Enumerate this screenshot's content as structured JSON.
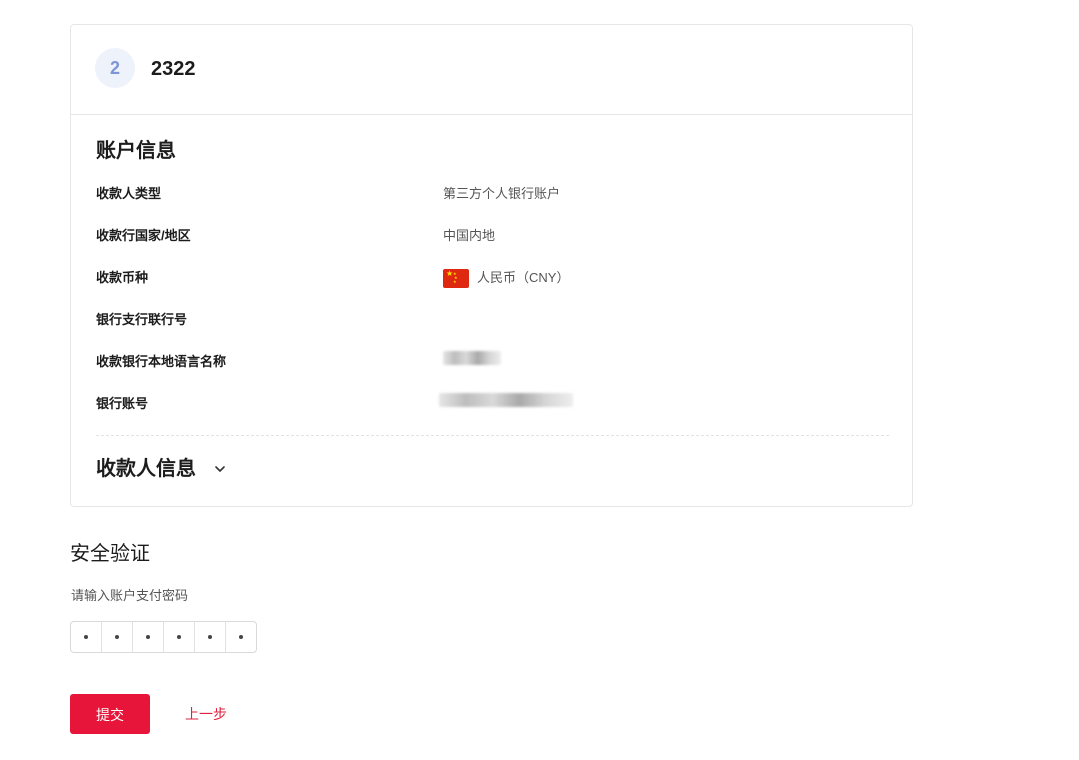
{
  "card": {
    "step_number": "2",
    "title": "2322"
  },
  "account_info": {
    "title": "账户信息",
    "rows": [
      {
        "label": "收款人类型",
        "value": "第三方个人银行账户"
      },
      {
        "label": "收款行国家/地区",
        "value": "中国内地"
      },
      {
        "label": "收款币种",
        "value": "人民币（CNY）",
        "icon": "china-flag-icon"
      },
      {
        "label": "银行支行联行号",
        "value": ""
      },
      {
        "label": "收款银行本地语言名称",
        "value": ""
      },
      {
        "label": "银行账号",
        "value": ""
      }
    ]
  },
  "payee_info": {
    "title": "收款人信息",
    "icon": "chevron-down-icon"
  },
  "security": {
    "title": "安全验证",
    "password_label": "请输入账户支付密码",
    "password_length": 6,
    "password_filled": 6
  },
  "actions": {
    "submit_label": "提交",
    "back_label": "上一步"
  },
  "colors": {
    "primary": "#e8153b",
    "step_circle_bg": "#eef2fb",
    "step_circle_text": "#7d95d8"
  }
}
